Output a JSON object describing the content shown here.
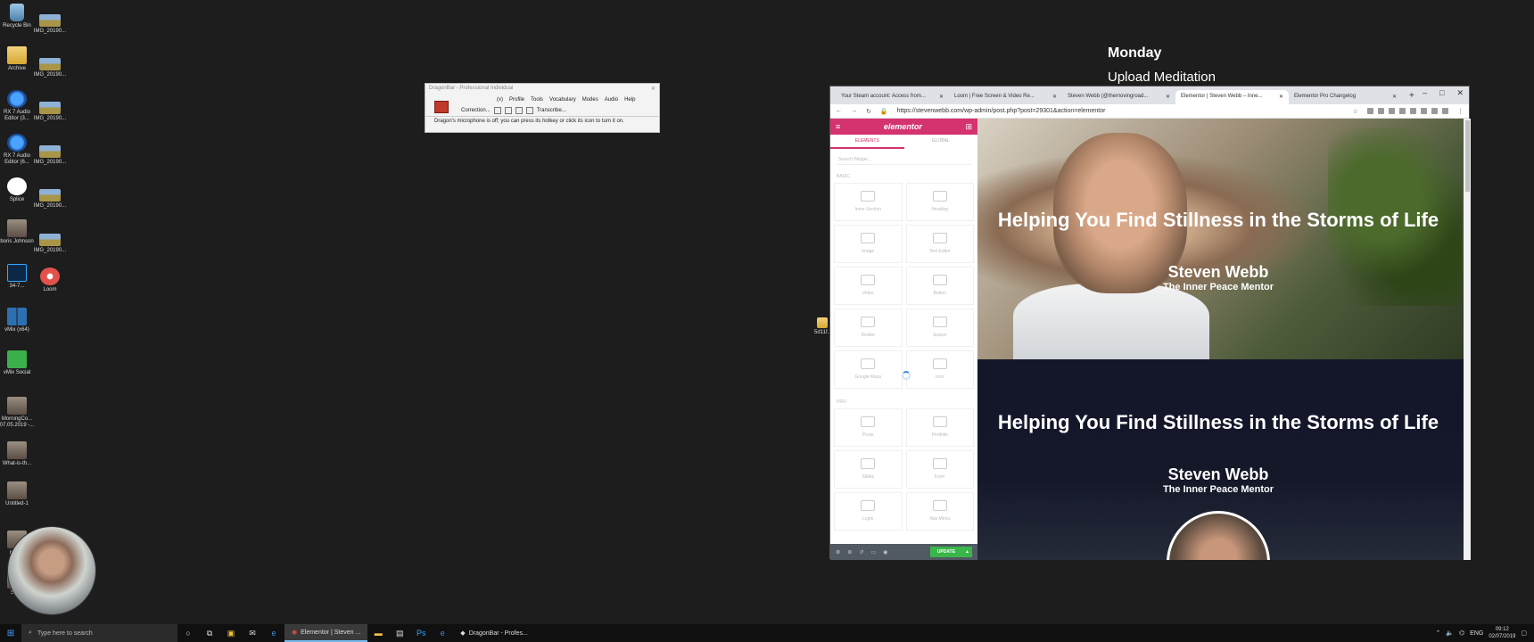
{
  "desktop": {
    "icons_left": [
      {
        "label": "Recycle Bin",
        "icon": "recycle-bin-icon"
      },
      {
        "label": "Archive",
        "icon": "folder-icon"
      },
      {
        "label": "RX 7 Audio Editor (3...",
        "icon": "rx-audio-icon"
      },
      {
        "label": "RX 7 Audio Editor (6...",
        "icon": "rx-audio-icon"
      },
      {
        "label": "Splice",
        "icon": "splice-icon"
      },
      {
        "label": "boris Johnson",
        "icon": "image-file-icon"
      },
      {
        "label": "34-7...",
        "icon": "photoshop-icon"
      },
      {
        "label": "vMix (x64)",
        "icon": "vmix-icon"
      },
      {
        "label": "vMix Social",
        "icon": "vmix-social-icon"
      },
      {
        "label": "MorningCo... 07.05.2019 -...",
        "icon": "image-file-icon"
      },
      {
        "label": "What-is-th...",
        "icon": "image-file-icon"
      },
      {
        "label": "Untitled-1",
        "icon": "image-file-icon"
      },
      {
        "label": "inne...",
        "icon": "image-file-icon"
      },
      {
        "label": "Ste...",
        "icon": "image-file-icon"
      }
    ],
    "icons_right": [
      {
        "label": "IMG_20190...",
        "icon": "image-file-icon"
      },
      {
        "label": "IMG_20190...",
        "icon": "image-file-icon"
      },
      {
        "label": "IMG_20190...",
        "icon": "image-file-icon"
      },
      {
        "label": "IMG_20190...",
        "icon": "image-file-icon"
      },
      {
        "label": "IMG_20190...",
        "icon": "image-file-icon"
      },
      {
        "label": "IMG_20190...",
        "icon": "image-file-icon"
      },
      {
        "label": "Loom",
        "icon": "loom-icon"
      }
    ],
    "stray_icon_label": "5d11f..",
    "overlay_title": "Monday",
    "overlay_subtitle": "Upload Meditation"
  },
  "dragon": {
    "title": "DragonBar - Professional Individual",
    "menus": [
      "(x)",
      "Profile",
      "Tools",
      "Vocabulary",
      "Modes",
      "Audio",
      "Help"
    ],
    "correction": "Correction...",
    "transcribe": "Transcribe...",
    "message": "Dragon's microphone is off; you can press its hotkey or click its icon to turn it on."
  },
  "browser": {
    "tabs": [
      {
        "label": "Your Steam account: Access from..."
      },
      {
        "label": "Loom | Free Screen & Video Re..."
      },
      {
        "label": "Steven Webb (@themovingroad..."
      },
      {
        "label": "Elementor | Steven Webb – Inne..."
      },
      {
        "label": "Elementor Pro Changelog"
      }
    ],
    "active_tab": 3,
    "url": "https://stevenwebb.com/wp-admin/post.php?post=29301&action=elementor",
    "window_controls": {
      "minimize": "–",
      "maximize": "□",
      "close": "✕"
    }
  },
  "elementor": {
    "logo": "elementor",
    "tab_elements": "ELEMENTS",
    "tab_global": "GLOBAL",
    "search_placeholder": "Search Widget...",
    "basic_label": "BASIC",
    "pro_label": "PRO",
    "basic_widgets": [
      "Inner Section",
      "Heading",
      "Image",
      "Text Editor",
      "Video",
      "Button",
      "Divider",
      "Spacer",
      "Google Maps",
      "Icon"
    ],
    "pro_widgets": [
      "Posts",
      "Portfolio",
      "Slides",
      "Form",
      "Login",
      "Nav Menu"
    ],
    "update_label": "UPDATE"
  },
  "page": {
    "hero_title": "Helping You Find Stillness in the Storms of Life",
    "hero_name": "Steven Webb",
    "hero_tagline": "The Inner Peace Mentor",
    "section2_title": "Helping You Find Stillness in the Storms of Life",
    "section2_name": "Steven Webb",
    "section2_tagline": "The Inner Peace Mentor"
  },
  "taskbar": {
    "search_placeholder": "Type here to search",
    "apps": [
      {
        "label": "Elementor | Steven ...",
        "icon": "chrome-icon",
        "active": true
      },
      {
        "label": "DragonBar - Profes...",
        "icon": "dragon-icon",
        "active": false
      }
    ],
    "language": "ENG",
    "time": "09:12",
    "date": "02/07/2019"
  }
}
